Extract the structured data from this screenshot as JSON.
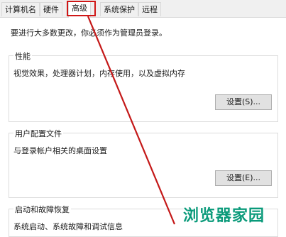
{
  "tabs": [
    {
      "label": "计算机名"
    },
    {
      "label": "硬件"
    },
    {
      "label": "高级"
    },
    {
      "label": "系统保护"
    },
    {
      "label": "远程"
    }
  ],
  "active_tab": "高级",
  "intro_text": "要进行大多数更改，你必须作为管理员登录。",
  "performance": {
    "title": "性能",
    "desc": "视觉效果，处理器计划，内存使用，以及虚拟内存",
    "button": "设置(S)..."
  },
  "user_profiles": {
    "title": "用户配置文件",
    "desc": "与登录帐户相关的桌面设置",
    "button": "设置(E)..."
  },
  "startup_recovery": {
    "title": "启动和故障恢复",
    "desc": "系统启动、系统故障和调试信息"
  },
  "watermark": "浏览器家园",
  "colors": {
    "highlight": "#d01717",
    "watermark": "#0a9a7a"
  }
}
